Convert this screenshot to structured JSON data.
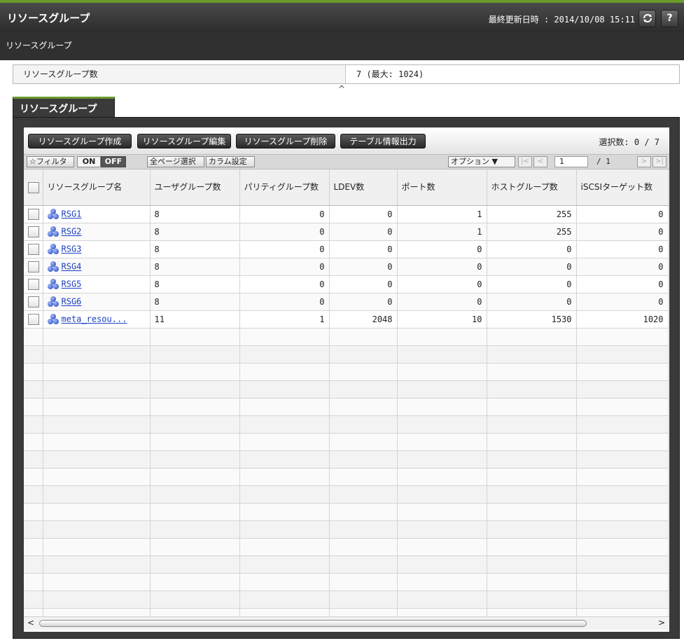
{
  "header": {
    "title": "リソースグループ",
    "last_updated": "最終更新日時 : 2014/10/08 15:11",
    "refresh_icon": "refresh-icon",
    "help_label": "?"
  },
  "breadcrumb": "リソースグループ",
  "summary": {
    "label": "リソースグループ数",
    "value": "7 (最大: 1024)"
  },
  "section": {
    "tab_label": "リソースグループ",
    "actions": [
      "リソースグループ作成",
      "リソースグループ編集",
      "リソースグループ削除",
      "テーブル情報出力"
    ],
    "selection": "選択数: 0 / 7"
  },
  "toolbar": {
    "filter": "☆フィルタ",
    "on": "ON",
    "off": "OFF",
    "select_all": "全ページ選択",
    "column_settings": "カラム設定",
    "options": "オプション ▼",
    "page_current": "1",
    "page_total": "/ 1"
  },
  "table": {
    "columns": [
      "リソースグループ名",
      "ユーザグループ数",
      "パリティグループ数",
      "LDEV数",
      "ポート数",
      "ホストグループ数",
      "iSCSIターゲット数"
    ],
    "rows": [
      [
        "RSG1",
        "8",
        "0",
        "0",
        "1",
        "255",
        "0"
      ],
      [
        "RSG2",
        "8",
        "0",
        "0",
        "1",
        "255",
        "0"
      ],
      [
        "RSG3",
        "8",
        "0",
        "0",
        "0",
        "0",
        "0"
      ],
      [
        "RSG4",
        "8",
        "0",
        "0",
        "0",
        "0",
        "0"
      ],
      [
        "RSG5",
        "8",
        "0",
        "0",
        "0",
        "0",
        "0"
      ],
      [
        "RSG6",
        "8",
        "0",
        "0",
        "0",
        "0",
        "0"
      ],
      [
        "meta_resou...",
        "11",
        "1",
        "2048",
        "10",
        "1530",
        "1020"
      ]
    ]
  },
  "scroll": {
    "left": "<",
    "right": ">"
  },
  "colors": {
    "accent": "#6a9a2a",
    "header_bg": "#2c2c2c",
    "link": "#1a3fc0"
  }
}
